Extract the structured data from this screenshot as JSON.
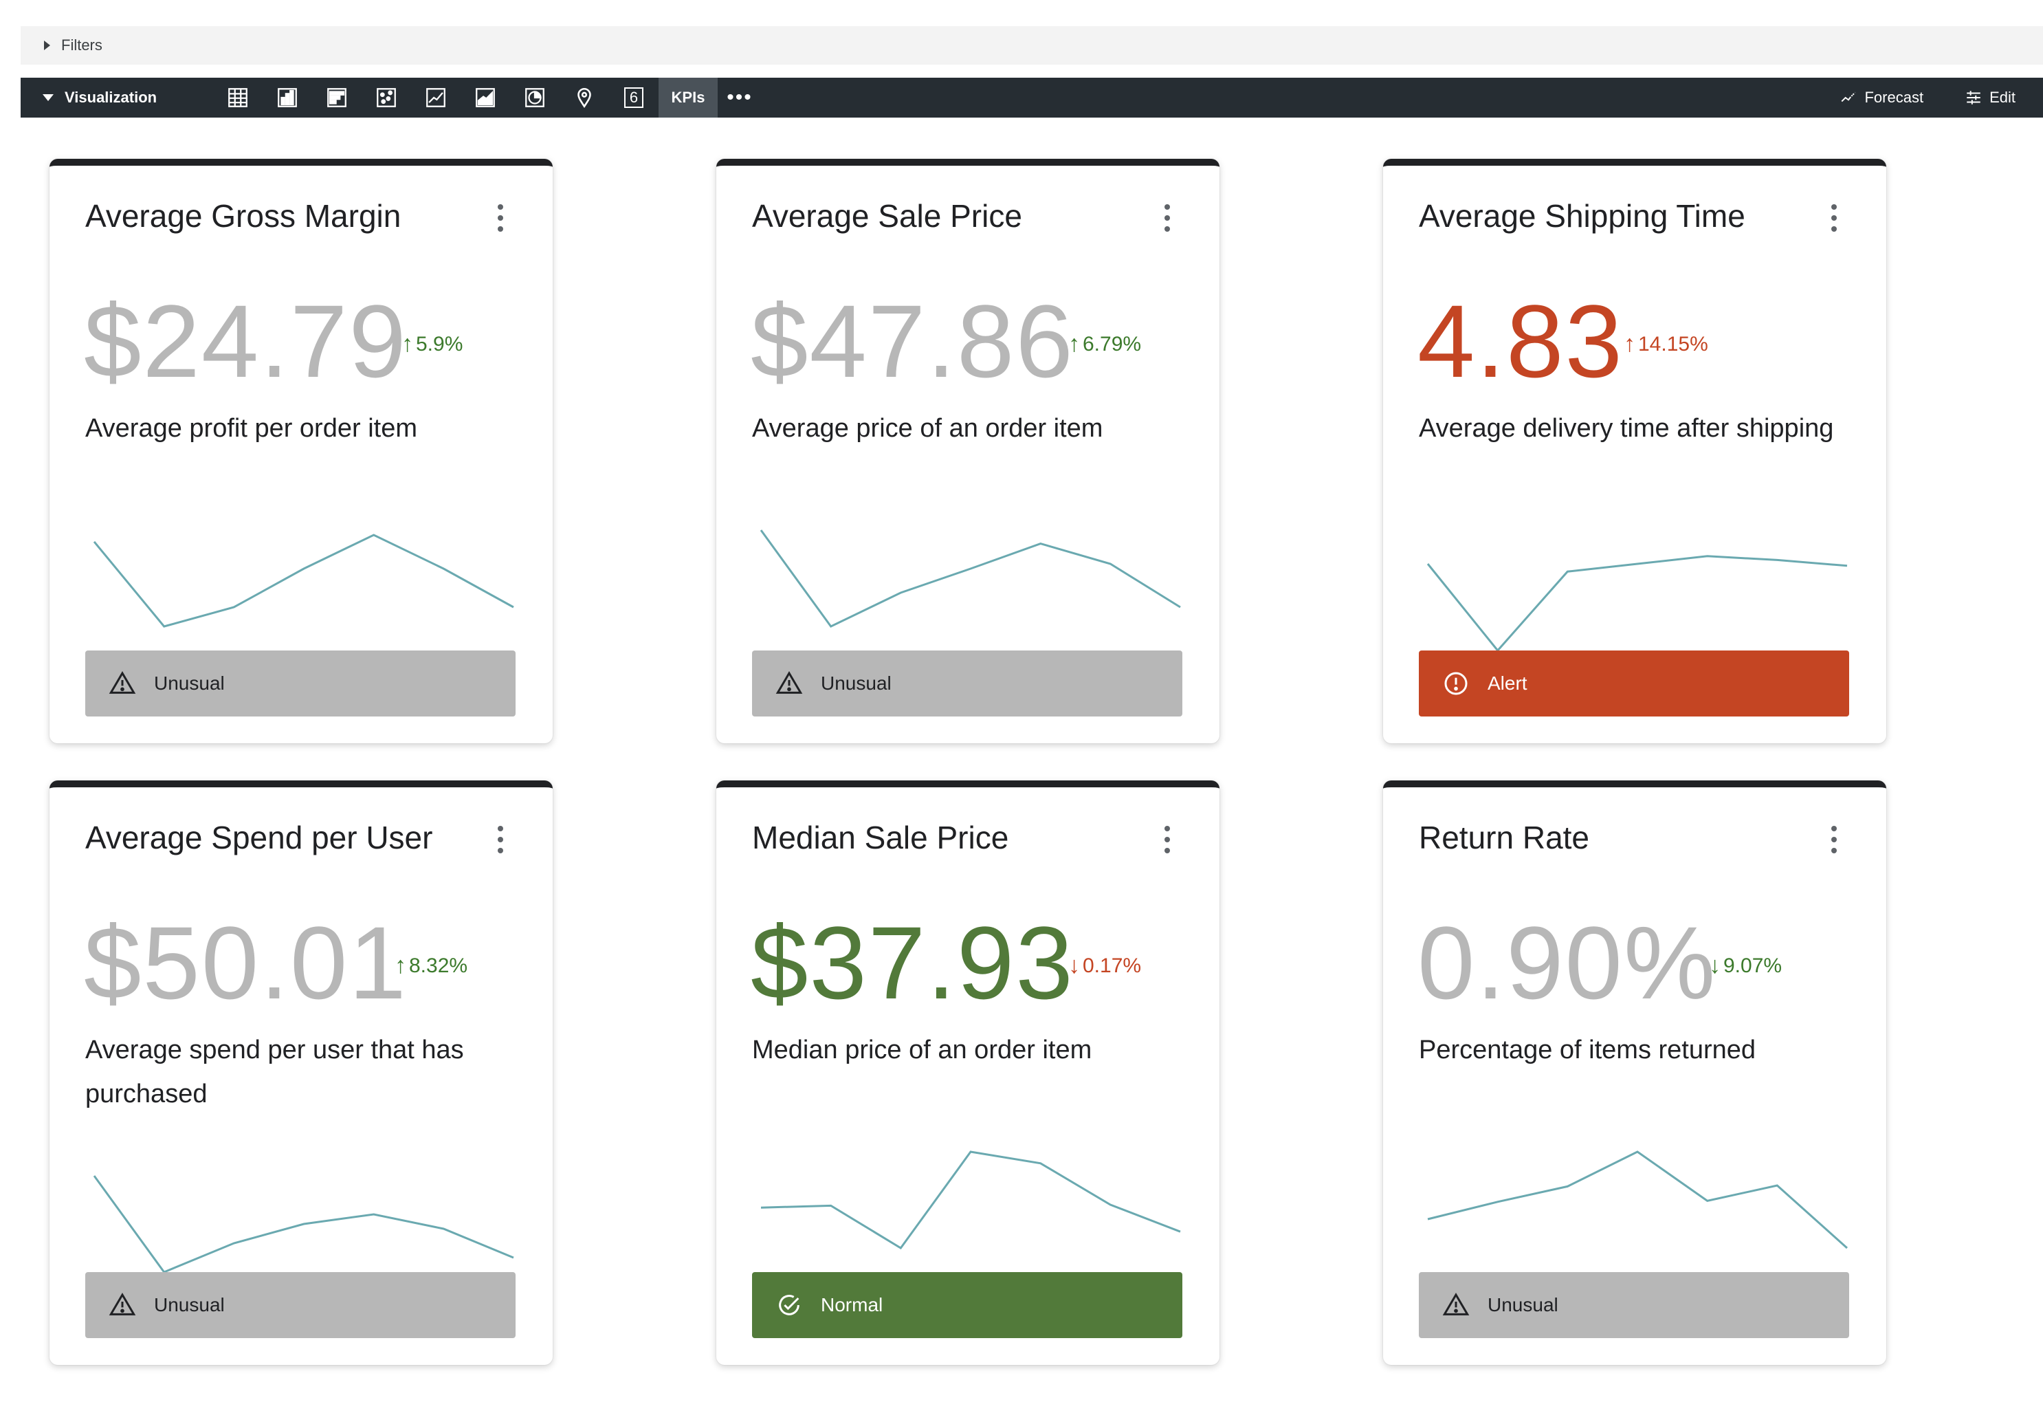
{
  "filters": {
    "label": "Filters"
  },
  "toolbar": {
    "visualization_label": "Visualization",
    "chart_icons": [
      "table-icon",
      "bar-chart-icon",
      "column-chart-icon",
      "scatter-icon",
      "line-chart-icon",
      "area-chart-icon",
      "pie-chart-icon",
      "map-pin-icon",
      "single-value-icon"
    ],
    "single_value_glyph": "6",
    "kpi_label": "KPIs",
    "more_label": "•••",
    "forecast_label": "Forecast",
    "edit_label": "Edit"
  },
  "colors": {
    "muted_value": "#b7b7b7",
    "alert": "#c44523",
    "normal": "#527a3a",
    "unusual_bg": "#b7b7b7",
    "spark": "#6aa9b0",
    "up_green": "#3c7a2c",
    "down_red": "#c44523"
  },
  "cards": [
    {
      "title": "Average Gross Margin",
      "value": "$24.79",
      "value_tone": "muted",
      "change": "5.9%",
      "direction": "up",
      "change_tone": "good",
      "description": "Average profit per order item",
      "status": "Unusual",
      "status_type": "unusual",
      "spark": [
        0.88,
        0.0,
        0.2,
        0.6,
        0.95,
        0.6,
        0.2
      ]
    },
    {
      "title": "Average Sale Price",
      "value": "$47.86",
      "value_tone": "muted",
      "change": "6.79%",
      "direction": "up",
      "change_tone": "good",
      "description": "Average price of an order item",
      "status": "Unusual",
      "status_type": "unusual",
      "spark": [
        1.0,
        0.0,
        0.35,
        0.6,
        0.86,
        0.65,
        0.2
      ]
    },
    {
      "title": "Average Shipping Time",
      "value": "4.83",
      "value_tone": "alert",
      "change": "14.15%",
      "direction": "up",
      "change_tone": "bad",
      "description": "Average delivery time after shipping",
      "status": "Alert",
      "status_type": "alert",
      "spark": [
        0.9,
        0.0,
        0.82,
        0.9,
        0.98,
        0.94,
        0.88
      ]
    },
    {
      "title": "Average Spend per User",
      "value": "$50.01",
      "value_tone": "muted",
      "change": "8.32%",
      "direction": "up",
      "change_tone": "good",
      "description": "Average spend per user that has purchased",
      "status": "Unusual",
      "status_type": "unusual",
      "spark": [
        1.0,
        0.0,
        0.3,
        0.5,
        0.6,
        0.45,
        0.15
      ]
    },
    {
      "title": "Median Sale Price",
      "value": "$37.93",
      "value_tone": "normal",
      "change": "0.17%",
      "direction": "down",
      "change_tone": "bad",
      "description": "Median price of an order item",
      "status": "Normal",
      "status_type": "normal",
      "spark": [
        0.42,
        0.44,
        0.0,
        1.0,
        0.88,
        0.45,
        0.17
      ]
    },
    {
      "title": "Return Rate",
      "value": "0.90%",
      "value_tone": "muted",
      "change": "9.07%",
      "direction": "down",
      "change_tone": "good",
      "description": "Percentage of items returned",
      "status": "Unusual",
      "status_type": "unusual",
      "spark": [
        0.3,
        0.48,
        0.64,
        1.0,
        0.49,
        0.65,
        0.0
      ]
    }
  ]
}
